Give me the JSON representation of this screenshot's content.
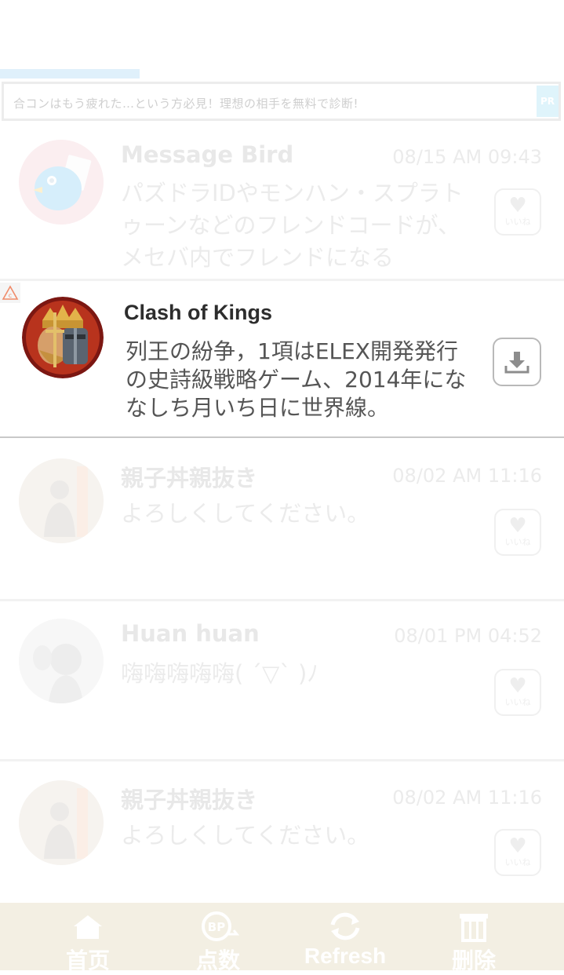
{
  "ad_banner": {
    "text": "合コンはもう疲れた…という方必見！理想の相手を無料で診断!",
    "pr": "PR"
  },
  "messages": [
    {
      "name": "Message Bird",
      "time": "08/15 AM 09:43",
      "text": "パズドラIDやモンハン・スプラトゥーンなどのフレンドコードが、メセバ内でフレンドになる",
      "like_label": "いいね",
      "avatar_icon": "bird-avatar"
    },
    {
      "name": "親子丼親抜き",
      "time": "08/02 AM 11:16",
      "text": "よろしくしてください。",
      "like_label": "いいね",
      "avatar_icon": "user-avatar"
    },
    {
      "name": "Huan huan",
      "time": "08/01 PM 04:52",
      "text": "嗨嗨嗨嗨嗨( ´▽` )ﾉ",
      "like_label": "いいね",
      "avatar_icon": "user-avatar"
    },
    {
      "name": "親子丼親抜き",
      "time": "08/02 AM 11:16",
      "text": "よろしくしてください。",
      "like_label": "いいね",
      "avatar_icon": "user-avatar"
    }
  ],
  "ad_card": {
    "title": "Clash of Kings",
    "description": "列王の紛争，1項はELEX開発発行の史詩級戦略ゲーム、2014年にななしち月いち日に世界線。",
    "icon": "download-icon"
  },
  "tabbar": {
    "items": [
      {
        "label": "首页",
        "icon": "home-icon"
      },
      {
        "label": "点数",
        "icon": "points-icon"
      },
      {
        "label": "Refresh",
        "icon": "refresh-icon"
      },
      {
        "label": "删除",
        "icon": "trash-icon"
      }
    ]
  },
  "colors": {
    "progress": "#dff0fb",
    "tabbar_bg": "#f3efe3",
    "faded_text": "#ebebeb",
    "ad_title": "#2d2d2d"
  }
}
